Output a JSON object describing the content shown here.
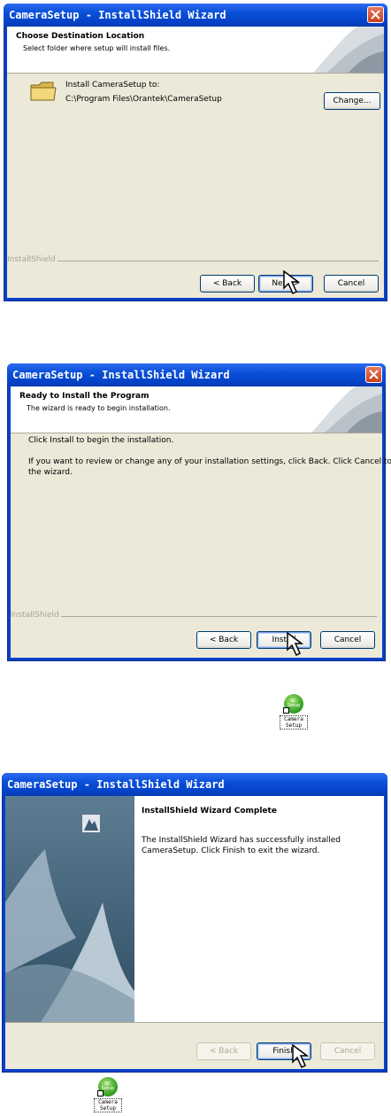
{
  "window_title": "CameraSetup - InstallShield Wizard",
  "dialog1": {
    "header_title": "Choose Destination Location",
    "header_subtitle": "Select folder where setup will install files.",
    "install_to_label": "Install CameraSetup to:",
    "install_path": "C:\\Program Files\\Orantek\\CameraSetup",
    "change_button": "Change...",
    "brand_label": "InstallShield",
    "back_button": "< Back",
    "next_button": "Next >",
    "cancel_button": "Cancel"
  },
  "dialog2": {
    "header_title": "Ready to Install the Program",
    "header_subtitle": "The wizard is ready to begin installation.",
    "line1": "Click Install to begin the installation.",
    "line2a": "If you want to review or change any of your installation settings, click Back. Click Cancel to exit",
    "line2b": "the wizard.",
    "brand_label": "InstallShield",
    "back_button": "< Back",
    "install_button": "Install",
    "cancel_button": "Cancel"
  },
  "desktop_icon": {
    "label_line1": "Camera",
    "label_line2": "Setup",
    "badge": "NC Setup"
  },
  "dialog3": {
    "title": "InstallShield Wizard Complete",
    "message_line1": "The InstallShield Wizard has successfully installed",
    "message_line2": "CameraSetup.  Click Finish to exit the wizard.",
    "back_button": "< Back",
    "finish_button": "Finish",
    "cancel_button": "Cancel"
  },
  "colors": {
    "titlebar": "#0a4fd8",
    "dialog_bg": "#ece9d8",
    "button_border": "#003c74"
  }
}
